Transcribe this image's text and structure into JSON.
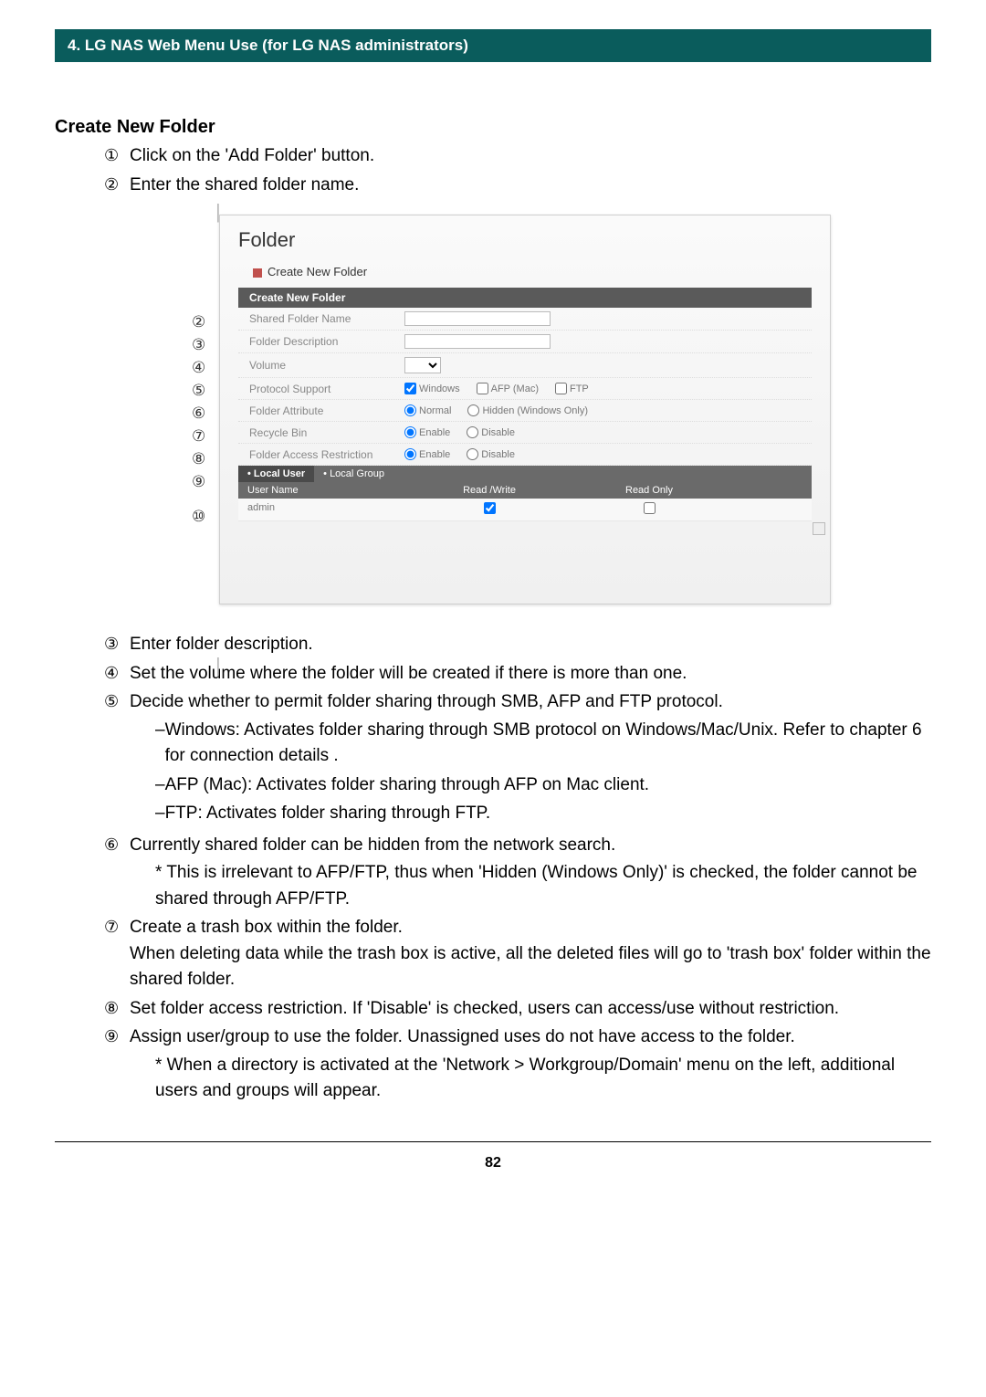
{
  "header": "4. LG NAS Web Menu Use (for LG NAS administrators)",
  "section_title": "Create New Folder",
  "steps_top": [
    {
      "num": "①",
      "text": "Click on the 'Add Folder' button."
    },
    {
      "num": "②",
      "text": "Enter the shared folder name."
    }
  ],
  "steps_bottom": [
    {
      "num": "③",
      "text": "Enter folder description."
    },
    {
      "num": "④",
      "text": "Set the volume where the folder will be created if there is more than one."
    },
    {
      "num": "⑤",
      "text": "Decide whether to permit folder sharing through SMB, AFP and FTP protocol.",
      "subs": [
        "Windows: Activates folder sharing through SMB protocol on Windows/Mac/Unix. Refer to chapter 6 for connection details .",
        "AFP (Mac): Activates folder sharing through AFP on Mac client.",
        "FTP: Activates folder sharing through FTP."
      ]
    },
    {
      "num": "⑥",
      "text": "Currently shared folder can be hidden from the network search.",
      "note": "* This is irrelevant to AFP/FTP, thus when 'Hidden (Windows Only)' is checked, the folder cannot be shared through AFP/FTP."
    },
    {
      "num": "⑦",
      "text": "Create a trash box within the folder.",
      "extra": "When deleting data while the trash box is active, all the deleted files will go to 'trash box' folder within the shared folder."
    },
    {
      "num": "⑧",
      "text": "Set folder access restriction. If 'Disable' is checked, users can access/use without restriction."
    },
    {
      "num": "⑨",
      "text": "Assign user/group to use the folder. Unassigned uses do not have access to the folder.",
      "note": "* When a directory is activated at the 'Network > Workgroup/Domain' menu on the left, additional users and groups will appear."
    }
  ],
  "labels": [
    "②",
    "③",
    "④",
    "⑤",
    "⑥",
    "⑦",
    "⑧",
    "⑨",
    "",
    "⑩"
  ],
  "ui": {
    "panel_title": "Folder",
    "panel_subtitle": "Create New Folder",
    "section_head": "Create New Folder",
    "rows": {
      "shared_name": "Shared Folder Name",
      "desc": "Folder Description",
      "volume": "Volume",
      "protocol": "Protocol Support",
      "attribute": "Folder Attribute",
      "recycle": "Recycle Bin",
      "restrict": "Folder Access Restriction"
    },
    "protocol_opts": {
      "win": "Windows",
      "afp": "AFP (Mac)",
      "ftp": "FTP"
    },
    "attribute_opts": {
      "normal": "Normal",
      "hidden": "Hidden (Windows Only)"
    },
    "enable_opts": {
      "enable": "Enable",
      "disable": "Disable"
    },
    "tabs": {
      "local_user": "• Local User",
      "local_group": "• Local Group"
    },
    "table": {
      "col1": "User Name",
      "col2": "Read /Write",
      "col3": "Read Only",
      "user": "admin"
    }
  },
  "page_number": "82"
}
